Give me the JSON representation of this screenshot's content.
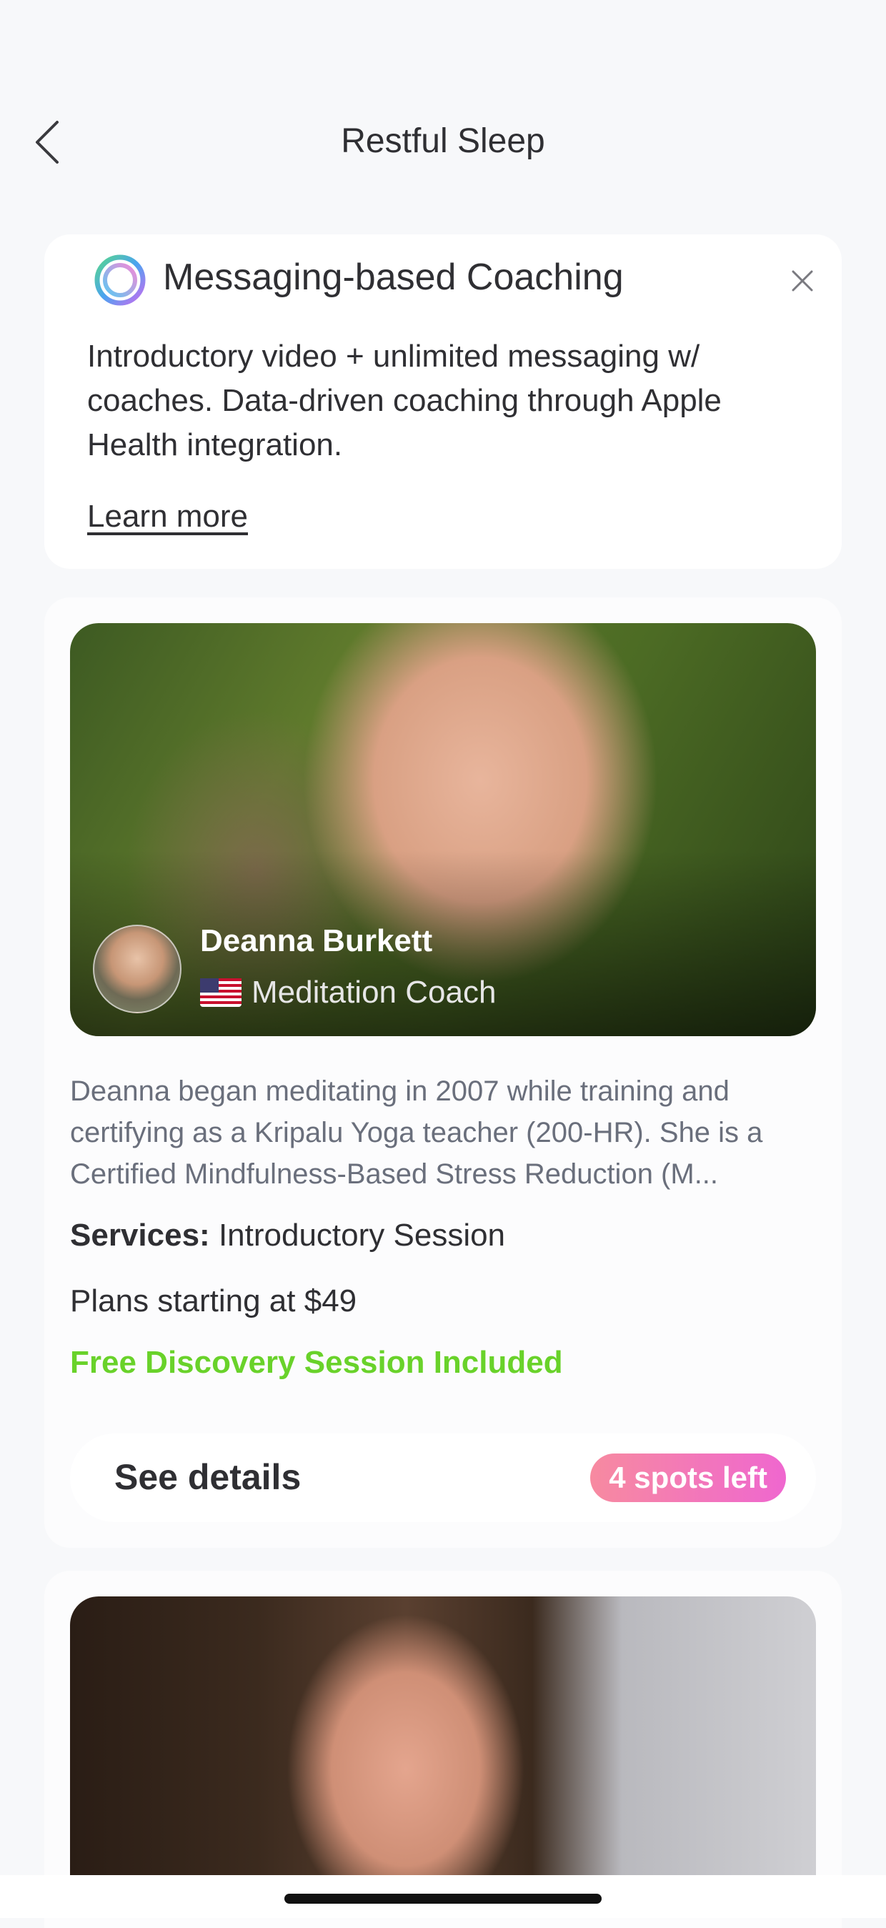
{
  "header": {
    "title": "Restful Sleep",
    "back_icon": "chevron-left-icon"
  },
  "info_card": {
    "title": "Messaging-based Coaching",
    "description": "Introductory video + unlimited messaging w/ coaches. Data-driven coaching through Apple Health integration.",
    "learn_more": "Learn more",
    "close_icon": "close-icon",
    "logo_icon": "gradient-ring-icon"
  },
  "coach": {
    "name": "Deanna Burkett",
    "flag": "🇺🇸",
    "role": "Meditation Coach",
    "bio": "Deanna began meditating in 2007 while training and certifying as a Kripalu Yoga teacher (200-HR). She is a Certified Mindfulness-Based Stress Reduction (M...",
    "services_label": "Services:",
    "services_value": "Introductory Session",
    "plans": "Plans starting at $49",
    "free_session": "Free Discovery Session Included",
    "details_button": "See details",
    "spots_badge": "4 spots left"
  },
  "colors": {
    "background": "#f7f8fa",
    "free_green": "#69d22a",
    "badge_gradient_start": "#f78aa0",
    "badge_gradient_end": "#ef67cf"
  }
}
